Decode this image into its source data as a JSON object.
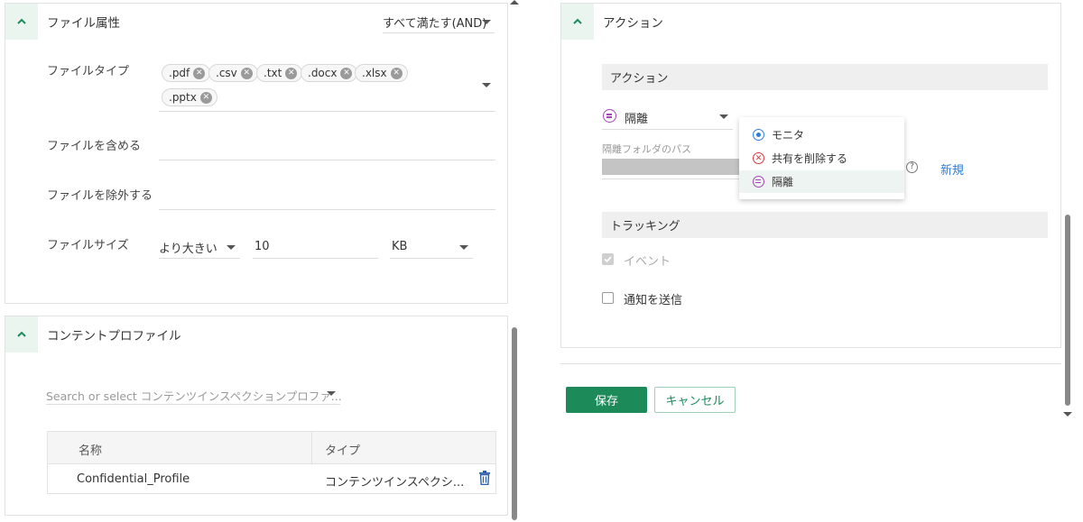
{
  "file_attributes": {
    "title": "ファイル属性",
    "match_mode": "すべて満たす(AND)",
    "file_type_label": "ファイルタイプ",
    "file_types": [
      ".pdf",
      ".csv",
      ".txt",
      ".docx",
      ".xlsx",
      ".pptx"
    ],
    "include_label": "ファイルを含める",
    "exclude_label": "ファイルを除外する",
    "size_label": "ファイルサイズ",
    "size_operator": "より大きい",
    "size_value": "10",
    "size_unit": "KB"
  },
  "content_profile": {
    "title": "コンテントプロファイル",
    "search_placeholder": "Search or select コンテンツインスペクションプロファ...",
    "columns": [
      "名称",
      "タイプ"
    ],
    "rows": [
      {
        "name": "Confidential_Profile",
        "type": "コンテンツインスペクシ..."
      }
    ]
  },
  "actions": {
    "title": "アクション",
    "section_action": "アクション",
    "selected_action": "隔離",
    "quarantine_path_label": "隔離フォルダのパス",
    "new_link": "新規",
    "dropdown_options": [
      {
        "label": "モニタ",
        "icon": "eye-icon",
        "color": "#2f7fd8"
      },
      {
        "label": "共有を削除する",
        "icon": "cancel-circle-icon",
        "color": "#d8383a"
      },
      {
        "label": "隔離",
        "icon": "quarantine-icon",
        "color": "#a347b5"
      }
    ],
    "section_tracking": "トラッキング",
    "event_label": "イベント",
    "notify_label": "通知を送信"
  },
  "footer": {
    "save_label": "保存",
    "cancel_label": "キャンセル"
  },
  "colors": {
    "accent": "#1d8a5a",
    "link": "#2f7fd8"
  }
}
